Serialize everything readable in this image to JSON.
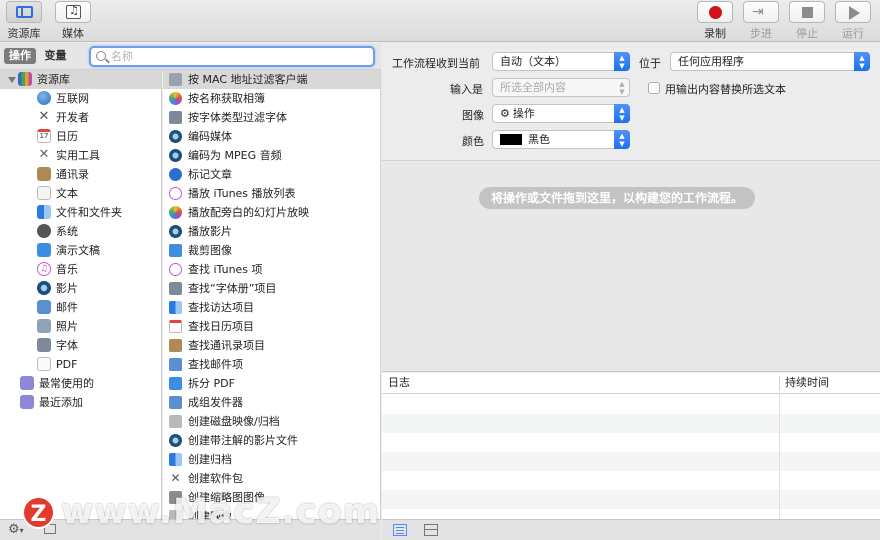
{
  "toolbar": {
    "library_label": "资源库",
    "media_label": "媒体",
    "record_label": "录制",
    "step_label": "步进",
    "stop_label": "停止",
    "run_label": "运行"
  },
  "left_header": {
    "tab_actions": "操作",
    "tab_variables": "变量",
    "search_placeholder": "名称"
  },
  "categories": {
    "root": "资源库",
    "items": [
      "互联网",
      "开发者",
      "日历",
      "实用工具",
      "通讯录",
      "文本",
      "文件和文件夹",
      "系统",
      "演示文稿",
      "音乐",
      "影片",
      "邮件",
      "照片",
      "字体",
      "PDF"
    ],
    "bottom": [
      "最常使用的",
      "最近添加"
    ]
  },
  "actions": [
    "按 MAC 地址过滤客户端",
    "按名称获取相簿",
    "按字体类型过滤字体",
    "编码媒体",
    "编码为 MPEG 音频",
    "标记文章",
    "播放 iTunes 播放列表",
    "播放配旁白的幻灯片放映",
    "播放影片",
    "裁剪图像",
    "查找 iTunes 项",
    "查找“字体册”项目",
    "查找访达项目",
    "查找日历项目",
    "查找通讯录项目",
    "查找邮件项",
    "拆分 PDF",
    "成组发件器",
    "创建磁盘映像/归档",
    "创建带注解的影片文件",
    "创建归档",
    "创建软件包",
    "创建缩略图图像",
    "创建映像"
  ],
  "settings": {
    "input_label": "工作流程收到当前",
    "input_value": "自动（文本）",
    "location_label": "位于",
    "location_value": "任何应用程序",
    "input_is_label": "输入是",
    "input_is_value": "所选全部内容",
    "checkbox_label": "用输出内容替换所选文本",
    "image_label": "图像",
    "image_value": "操作",
    "color_label": "颜色",
    "color_value": "黑色",
    "swatch_color": "#000000"
  },
  "canvas": {
    "hint": "将操作或文件拖到这里，以构建您的工作流程。"
  },
  "log": {
    "col_log": "日志",
    "col_duration": "持续时间"
  },
  "watermark": {
    "logo": "Z",
    "text": "www.MacZ.com"
  },
  "colors": {
    "accent": "#1f6ff0",
    "record": "#d0101a"
  }
}
